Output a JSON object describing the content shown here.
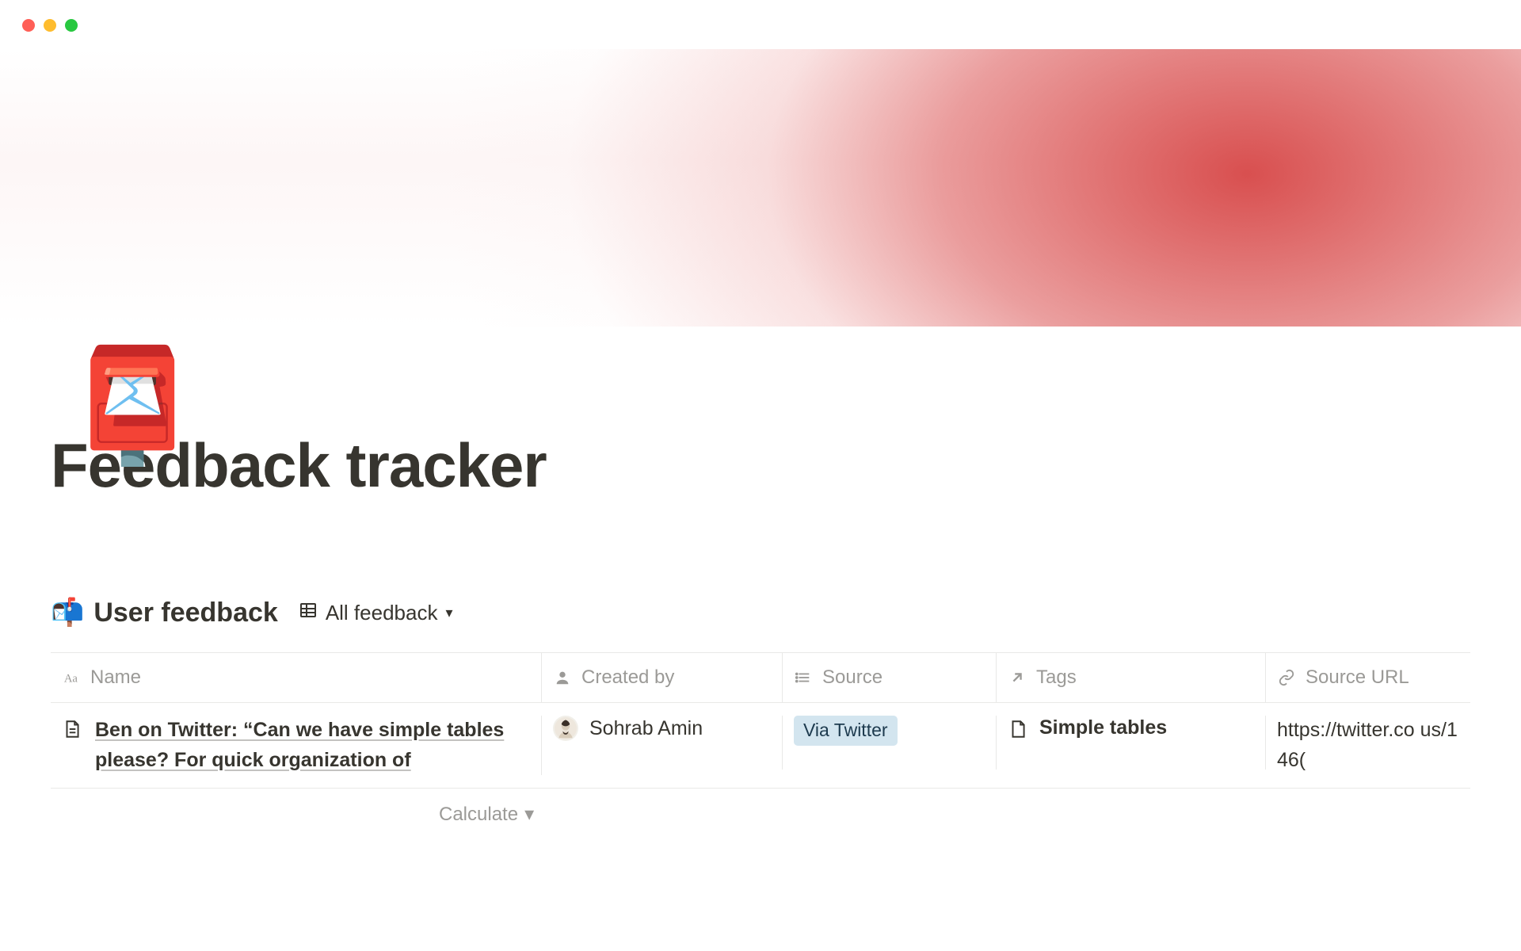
{
  "page": {
    "title": "Feedback tracker",
    "icon_emoji": "📮"
  },
  "database": {
    "icon_emoji": "📬",
    "title": "User feedback",
    "view": {
      "label": "All feedback"
    },
    "columns": {
      "name": "Name",
      "created_by": "Created by",
      "source": "Source",
      "tags": "Tags",
      "source_url": "Source URL"
    },
    "rows": [
      {
        "name": "Ben on Twitter: “Can we have simple tables please? For quick organization of",
        "created_by": "Sohrab Amin",
        "source": "Via Twitter",
        "tag": "Simple tables",
        "source_url": "https://twitter.co us/146("
      }
    ],
    "calculate_label": "Calculate"
  }
}
